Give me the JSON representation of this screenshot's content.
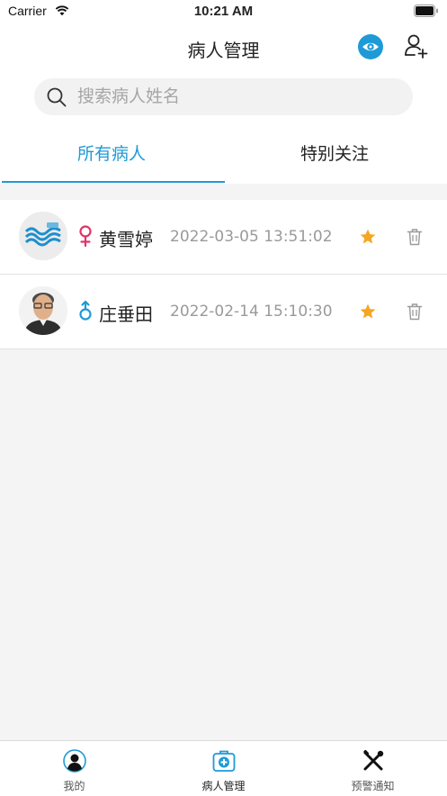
{
  "status_bar": {
    "carrier": "Carrier",
    "time": "10:21 AM"
  },
  "nav": {
    "title": "病人管理"
  },
  "search": {
    "placeholder": "搜索病人姓名"
  },
  "tabs": [
    {
      "label": "所有病人",
      "active": true
    },
    {
      "label": "特别关注",
      "active": false
    }
  ],
  "patients": [
    {
      "name": "黄雪婷",
      "gender": "female",
      "datetime": "2022-03-05 13:51:02",
      "starred": true
    },
    {
      "name": "庄垂田",
      "gender": "male",
      "datetime": "2022-02-14 15:10:30",
      "starred": true
    }
  ],
  "tabbar": [
    {
      "label": "我的",
      "icon": "user-icon",
      "active": false
    },
    {
      "label": "病人管理",
      "icon": "medical-kit-icon",
      "active": true
    },
    {
      "label": "预警通知",
      "icon": "tools-icon",
      "active": false
    }
  ],
  "colors": {
    "accent": "#1e9ad6",
    "female": "#e0336b",
    "male": "#1e9ad6",
    "star": "#f5a623"
  }
}
